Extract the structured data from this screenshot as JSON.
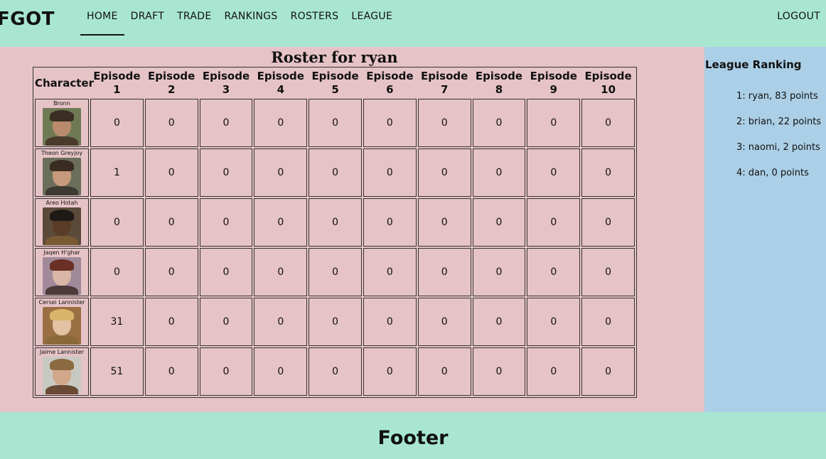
{
  "nav": {
    "brand": "FGOT",
    "links": [
      "HOME",
      "DRAFT",
      "TRADE",
      "RANKINGS",
      "ROSTERS",
      "LEAGUE"
    ],
    "active": "HOME",
    "logout": "LOGOUT"
  },
  "roster": {
    "title": "Roster for ryan",
    "columns": [
      "Character",
      "Episode 1",
      "Episode 2",
      "Episode 3",
      "Episode 4",
      "Episode 5",
      "Episode 6",
      "Episode 7",
      "Episode 8",
      "Episode 9",
      "Episode 10"
    ],
    "rows": [
      {
        "name": "Bronn",
        "scores": [
          "0",
          "0",
          "0",
          "0",
          "0",
          "0",
          "0",
          "0",
          "0",
          "0"
        ]
      },
      {
        "name": "Theon Greyjoy",
        "scores": [
          "1",
          "0",
          "0",
          "0",
          "0",
          "0",
          "0",
          "0",
          "0",
          "0"
        ]
      },
      {
        "name": "Areo Hotah",
        "scores": [
          "0",
          "0",
          "0",
          "0",
          "0",
          "0",
          "0",
          "0",
          "0",
          "0"
        ]
      },
      {
        "name": "Jaqen H'ghar",
        "scores": [
          "0",
          "0",
          "0",
          "0",
          "0",
          "0",
          "0",
          "0",
          "0",
          "0"
        ]
      },
      {
        "name": "Cersei Lannister",
        "scores": [
          "31",
          "0",
          "0",
          "0",
          "0",
          "0",
          "0",
          "0",
          "0",
          "0"
        ]
      },
      {
        "name": "Jaime Lannister",
        "scores": [
          "51",
          "0",
          "0",
          "0",
          "0",
          "0",
          "0",
          "0",
          "0",
          "0"
        ]
      }
    ]
  },
  "portraits": [
    {
      "bg": "#6f7a55",
      "hair": "#3b2e22",
      "body": "#4a3b2a",
      "skin": "#b98b6c"
    },
    {
      "bg": "#6b6f5a",
      "hair": "#3a2c20",
      "body": "#3d3a33",
      "skin": "#c79a7c"
    },
    {
      "bg": "#5b4a3a",
      "hair": "#1e1a16",
      "body": "#7a5a35",
      "skin": "#5a3b28"
    },
    {
      "bg": "#a08a9a",
      "hair": "#6a2f25",
      "body": "#4d3a3a",
      "skin": "#d8b7a6"
    },
    {
      "bg": "#9a6f42",
      "hair": "#d8b56a",
      "body": "#8a6a3a",
      "skin": "#e2c2a3"
    },
    {
      "bg": "#c9c9c3",
      "hair": "#8a6a3e",
      "body": "#6a4a35",
      "skin": "#d2a88a"
    }
  ],
  "sidebar": {
    "title": "League Ranking",
    "rankings": [
      "1: ryan, 83 points",
      "2: brian, 22 points",
      "3: naomi, 2 points",
      "4: dan, 0 points"
    ]
  },
  "footer": {
    "text": "Footer"
  }
}
